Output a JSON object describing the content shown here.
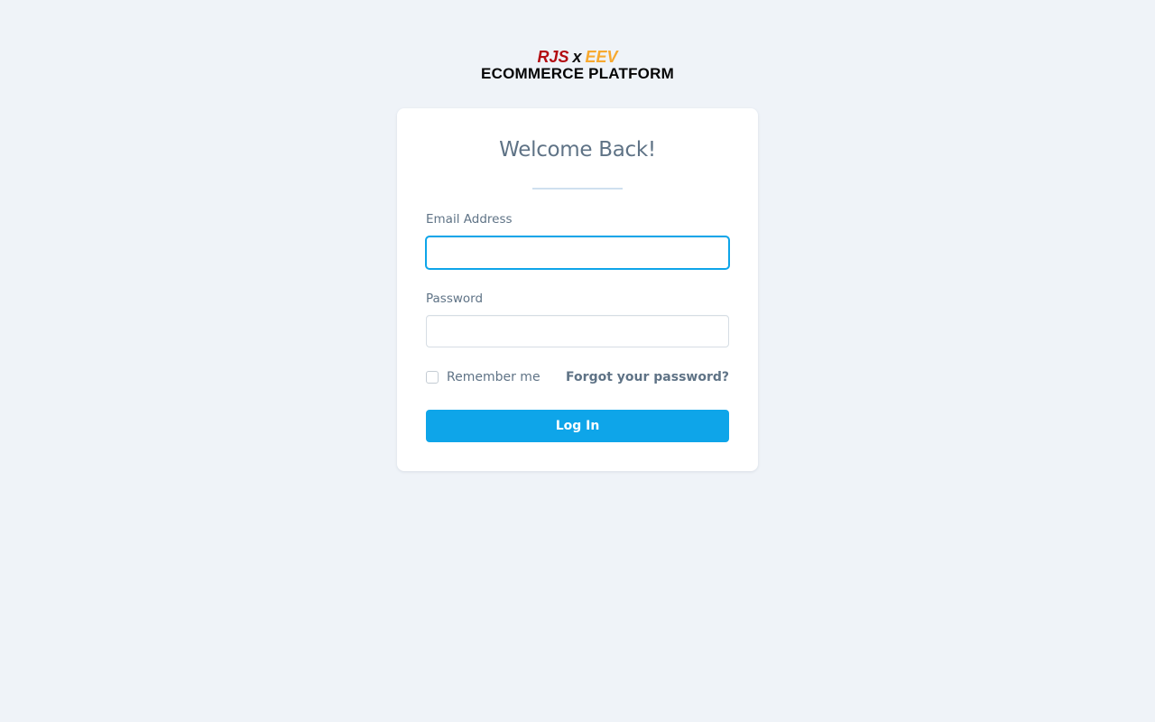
{
  "logo": {
    "brand_left": "RJS",
    "brand_x": "x",
    "brand_right": "EEV",
    "subtitle": "ECOMMERCE PLATFORM"
  },
  "login": {
    "title": "Welcome Back!",
    "email_label": "Email Address",
    "email_value": "",
    "password_label": "Password",
    "password_value": "",
    "remember_label": "Remember me",
    "remember_checked": false,
    "forgot_label": "Forgot your password?",
    "submit_label": "Log In"
  },
  "colors": {
    "background": "#eff3f8",
    "accent": "#0ea5e9",
    "text_muted": "#5f7386",
    "brand_red": "#b30d12",
    "brand_orange": "#f7a930"
  }
}
